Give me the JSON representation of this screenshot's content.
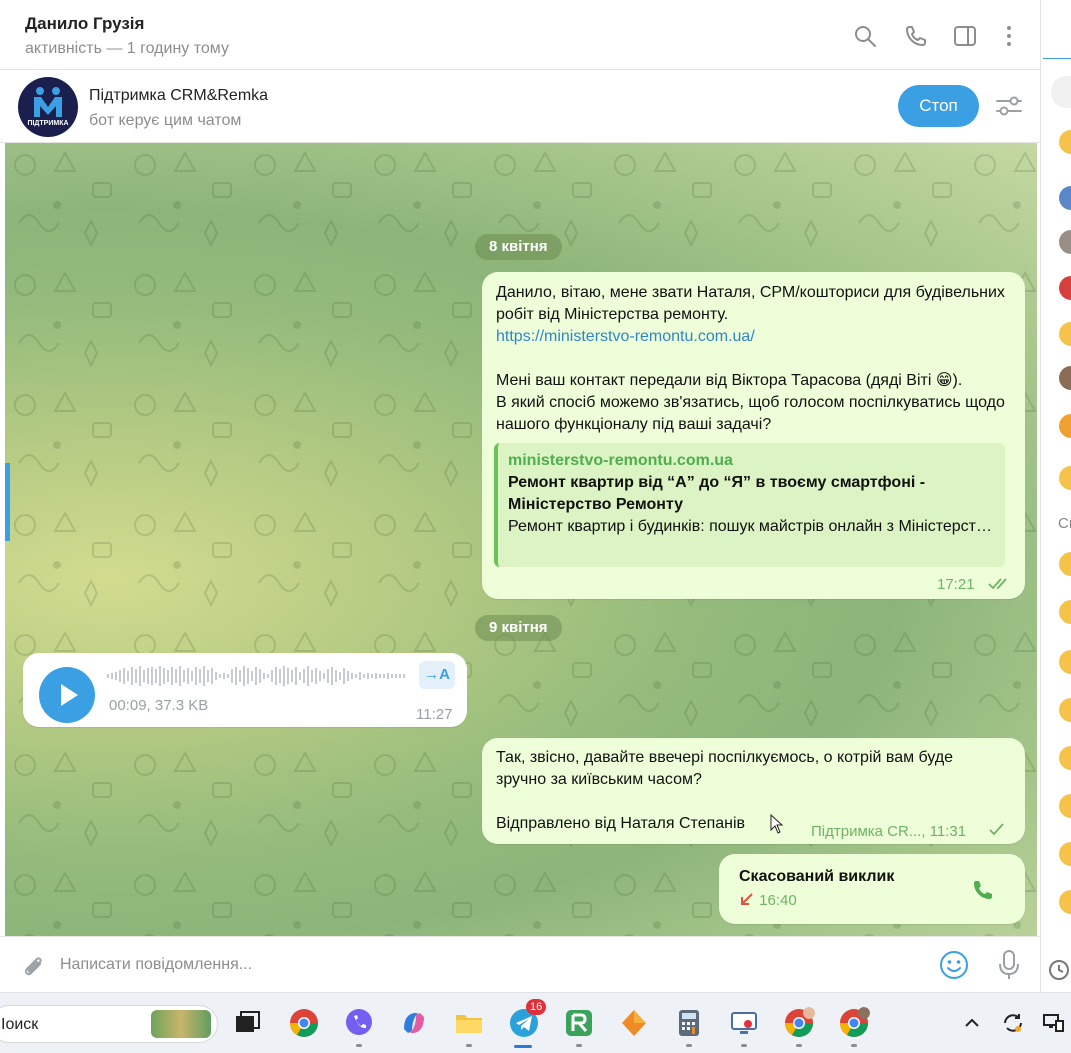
{
  "header": {
    "title": "Данило Грузія",
    "subtitle": "активність — 1 годину тому"
  },
  "bot_bar": {
    "avatar_text": "ПІДТРИМКА",
    "title": "Підтримка CRM&Remka",
    "subtitle": "бот керує цим чатом",
    "stop_label": "Стоп"
  },
  "messages": {
    "date1": "8 квітня",
    "msg1_text": "Данило, вітаю, мене звати Наталя, СРМ/кошториси для будівельних робіт від Міністерства ремонту.",
    "msg1_link": "https://ministerstvo-remontu.com.ua/",
    "msg1_text2": "Мені ваш контакт передали від Віктора Тарасова (дяді Віті 😁).\nВ який спосіб можемо зв'язатись, щоб голосом поспілкуватись щодо нашого функціоналу під ваші задачі?",
    "msg1_preview_site": "ministerstvo-remontu.com.ua",
    "msg1_preview_title": "Ремонт квартир від “А” до “Я” в твоєму смартфоні - Міністерство Ремонту",
    "msg1_preview_desc": "Ремонт квартир і будинків: пошук майстрів онлайн з Міністерством Ремонту. Перевірені будівельні майстри, про...",
    "msg1_time": "17:21",
    "date2": "9 квітня",
    "voice_meta": "00:09, 37.3 KB",
    "voice_transcribe": "→A",
    "voice_time": "11:27",
    "msg3_text": "Так, звісно, давайте ввечері поспілкуємось, о котрій вам буде зручно за київським часом?\n\nВідправлено від Наталя Степанів",
    "msg3_meta": "Підтримка CR..., 11:31",
    "call_title": "Скасований виклик",
    "call_time": "16:40"
  },
  "composer": {
    "placeholder": "Написати повідомлення..."
  },
  "right_panel": {
    "label": "Cr"
  },
  "taskbar": {
    "search_text": "Іоиск",
    "telegram_badge": "16"
  },
  "colors": {
    "accent": "#3a9fe3",
    "bubble_out": "#eefed9",
    "time_green": "#6eb364"
  }
}
